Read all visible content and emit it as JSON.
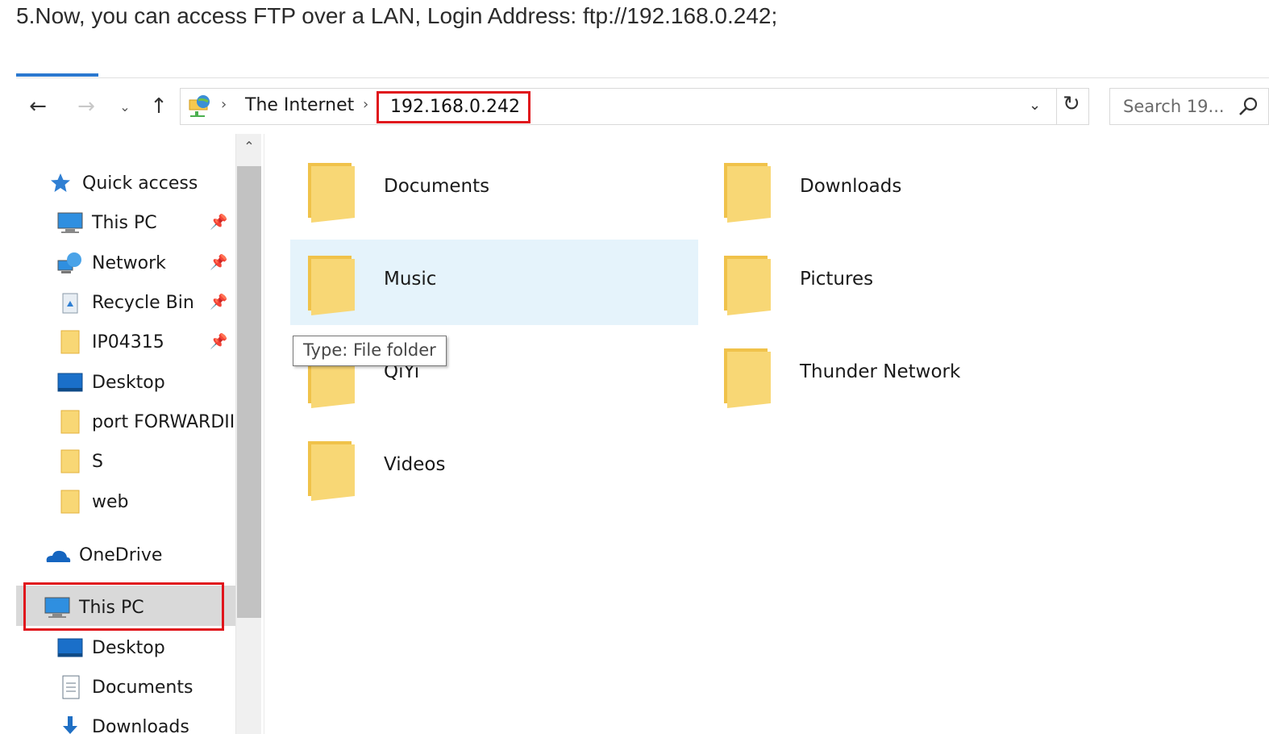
{
  "instruction": "5.Now, you can access FTP over a LAN, Login Address: ftp://192.168.0.242;",
  "toolbar": {
    "back_glyph": "←",
    "forward_glyph": "→",
    "recent_glyph": "⌄",
    "up_glyph": "↑"
  },
  "address_bar": {
    "breadcrumb": [
      "The Internet",
      "192.168.0.242"
    ],
    "separator": "›",
    "dropdown_glyph": "⌄",
    "refresh_glyph": "↻"
  },
  "search": {
    "placeholder": "Search 19..."
  },
  "nav_pane": {
    "quick_access": "Quick access",
    "pinned": [
      {
        "label": "This PC",
        "icon": "monitor-icon",
        "pinned": true
      },
      {
        "label": "Network",
        "icon": "network-icon",
        "pinned": true
      },
      {
        "label": "Recycle Bin",
        "icon": "recycle-bin-icon",
        "pinned": true
      },
      {
        "label": "IP04315",
        "icon": "folder-icon",
        "pinned": true
      },
      {
        "label": "Desktop",
        "icon": "desktop-icon",
        "pinned": false
      },
      {
        "label": "port FORWARDII",
        "icon": "folder-icon",
        "pinned": false
      },
      {
        "label": "S",
        "icon": "folder-icon",
        "pinned": false
      },
      {
        "label": "web",
        "icon": "folder-icon",
        "pinned": false
      }
    ],
    "onedrive": "OneDrive",
    "this_pc": "This PC",
    "this_pc_children": [
      "Desktop",
      "Documents",
      "Downloads"
    ],
    "pin_glyph": "📌",
    "scroll_up_glyph": "⌃"
  },
  "content": {
    "items": [
      {
        "label": "Documents"
      },
      {
        "label": "Downloads"
      },
      {
        "label": "Music"
      },
      {
        "label": "Pictures"
      },
      {
        "label": "QiYi"
      },
      {
        "label": "Thunder Network"
      },
      {
        "label": "Videos"
      }
    ],
    "tooltip": "Type: File folder"
  },
  "colors": {
    "accent": "#2b79d0",
    "highlight_box": "#e0151c",
    "selection": "#e5f3fb",
    "folder": "#f8d775"
  }
}
